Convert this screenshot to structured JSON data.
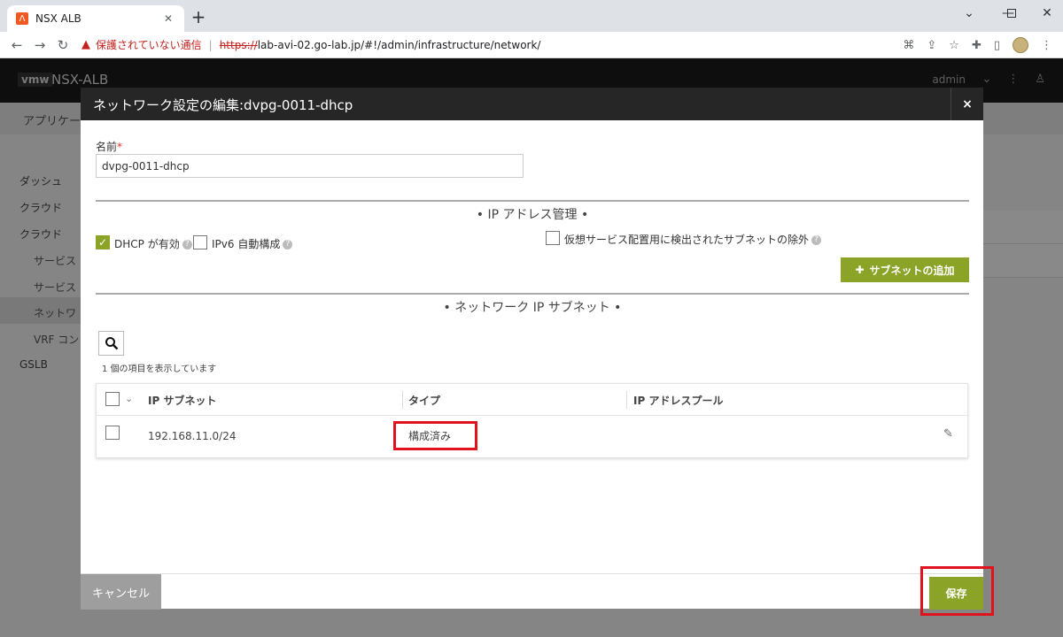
{
  "browser": {
    "tab_title": "NSX ALB",
    "favicon_glyph": "Λ",
    "insecure_text": "保護されていない通信",
    "url_scheme": "https://",
    "url_rest": "lab-avi-02.go-lab.jp/#!/admin/infrastructure/network/"
  },
  "app": {
    "logo": "vmw",
    "name": "NSX-ALB",
    "user": "admin",
    "subheader": "アプリケー",
    "sidebar": [
      "ダッシュ",
      "クラウド",
      "クラウド",
      "サービス",
      "サービス",
      "ネットワ",
      "VRF コン",
      "GSLB"
    ]
  },
  "modal": {
    "title": "ネットワーク設定の編集:dvpg-0011-dhcp",
    "close_glyph": "×",
    "name_label": "名前",
    "required_mark": "*",
    "name_value": "dvpg-0011-dhcp",
    "ip_section_title": "• IP アドレス管理 •",
    "dhcp_label": "DHCP が有効",
    "dhcp_checked": true,
    "ipv6_label": "IPv6 自動構成",
    "ipv6_checked": false,
    "exclude_label": "仮想サービス配置用に検出されたサブネットの除外",
    "exclude_checked": false,
    "add_subnet_label": "サブネットの追加",
    "subnet_section_title": "• ネットワーク IP サブネット •",
    "count_text": "1 個の項目を表示しています",
    "columns": [
      "IP サブネット",
      "タイプ",
      "IP アドレスプール"
    ],
    "rows": [
      {
        "subnet": "192.168.11.0/24",
        "type": "構成済み",
        "pool": ""
      }
    ],
    "cancel_label": "キャンセル",
    "save_label": "保存"
  },
  "colors": {
    "accent": "#8ba326",
    "highlight": "#e0121e"
  }
}
